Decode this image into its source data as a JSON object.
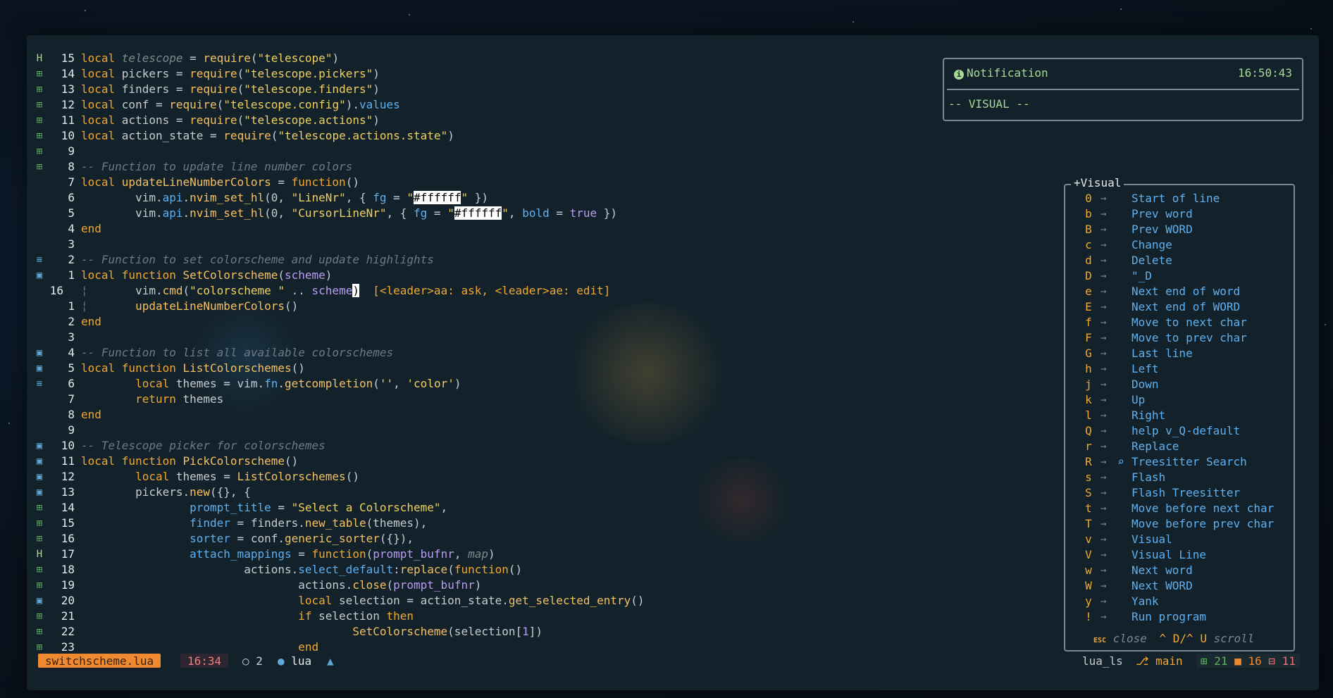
{
  "editor": {
    "lines": [
      {
        "sign": "H",
        "num": "15",
        "segs": [
          [
            "kw",
            "local "
          ],
          [
            "it",
            "telescope"
          ],
          [
            "var",
            " = "
          ],
          [
            "fn",
            "require"
          ],
          [
            "var",
            "("
          ],
          [
            "str",
            "\"telescope\""
          ],
          [
            "var",
            ")"
          ]
        ]
      },
      {
        "sign": "⊞",
        "num": "14",
        "segs": [
          [
            "kw",
            "local "
          ],
          [
            "var",
            "pickers = "
          ],
          [
            "fn",
            "require"
          ],
          [
            "var",
            "("
          ],
          [
            "str",
            "\"telescope.pickers\""
          ],
          [
            "var",
            ")"
          ]
        ]
      },
      {
        "sign": "⊞",
        "num": "13",
        "segs": [
          [
            "kw",
            "local "
          ],
          [
            "var",
            "finders = "
          ],
          [
            "fn",
            "require"
          ],
          [
            "var",
            "("
          ],
          [
            "str",
            "\"telescope.finders\""
          ],
          [
            "var",
            ")"
          ]
        ]
      },
      {
        "sign": "⊞",
        "num": "12",
        "segs": [
          [
            "kw",
            "local "
          ],
          [
            "var",
            "conf = "
          ],
          [
            "fn",
            "require"
          ],
          [
            "var",
            "("
          ],
          [
            "str",
            "\"telescope.config\""
          ],
          [
            "var",
            ")."
          ],
          [
            "prop",
            "values"
          ]
        ]
      },
      {
        "sign": "⊞",
        "num": "11",
        "segs": [
          [
            "kw",
            "local "
          ],
          [
            "var",
            "actions = "
          ],
          [
            "fn",
            "require"
          ],
          [
            "var",
            "("
          ],
          [
            "str",
            "\"telescope.actions\""
          ],
          [
            "var",
            ")"
          ]
        ]
      },
      {
        "sign": "⊞",
        "num": "10",
        "segs": [
          [
            "kw",
            "local "
          ],
          [
            "var",
            "action_state = "
          ],
          [
            "fn",
            "require"
          ],
          [
            "var",
            "("
          ],
          [
            "str",
            "\"telescope.actions.state\""
          ],
          [
            "var",
            ")"
          ]
        ]
      },
      {
        "sign": "⊞",
        "num": "9",
        "segs": []
      },
      {
        "sign": "⊞",
        "num": "8",
        "segs": [
          [
            "cm",
            "-- Function to update line number colors"
          ]
        ]
      },
      {
        "sign": "",
        "num": "7",
        "segs": [
          [
            "kw",
            "local "
          ],
          [
            "fn",
            "updateLineNumberColors"
          ],
          [
            "var",
            " = "
          ],
          [
            "kw",
            "function"
          ],
          [
            "var",
            "()"
          ]
        ]
      },
      {
        "sign": "",
        "num": "6",
        "segs": [
          [
            "var",
            "        vim."
          ],
          [
            "prop",
            "api"
          ],
          [
            "var",
            "."
          ],
          [
            "fn",
            "nvim_set_hl"
          ],
          [
            "var",
            "(0, "
          ],
          [
            "str",
            "\"LineNr\""
          ],
          [
            "var",
            ", { "
          ],
          [
            "prop",
            "fg"
          ],
          [
            "var",
            " = "
          ],
          [
            "str",
            "\""
          ],
          [
            "hl",
            "#ffffff"
          ],
          [
            "str",
            "\""
          ],
          [
            "var",
            " })"
          ]
        ]
      },
      {
        "sign": "",
        "num": "5",
        "segs": [
          [
            "var",
            "        vim."
          ],
          [
            "prop",
            "api"
          ],
          [
            "var",
            "."
          ],
          [
            "fn",
            "nvim_set_hl"
          ],
          [
            "var",
            "(0, "
          ],
          [
            "str",
            "\"CursorLineNr\""
          ],
          [
            "var",
            ", { "
          ],
          [
            "prop",
            "fg"
          ],
          [
            "var",
            " = "
          ],
          [
            "str",
            "\""
          ],
          [
            "hl",
            "#ffffff"
          ],
          [
            "str",
            "\""
          ],
          [
            "var",
            ", "
          ],
          [
            "prop",
            "bold"
          ],
          [
            "var",
            " = "
          ],
          [
            "bool",
            "true"
          ],
          [
            "var",
            " })"
          ]
        ]
      },
      {
        "sign": "",
        "num": "4",
        "segs": [
          [
            "kw",
            "end"
          ]
        ]
      },
      {
        "sign": "",
        "num": "3",
        "segs": []
      },
      {
        "sign": "≡",
        "num": "2",
        "segs": [
          [
            "cm",
            "-- Function to set colorscheme and update highlights"
          ]
        ]
      },
      {
        "sign": "▣",
        "num": "1",
        "segs": [
          [
            "kw",
            "local function "
          ],
          [
            "fn",
            "SetColorscheme"
          ],
          [
            "var",
            "("
          ],
          [
            "par",
            "scheme"
          ],
          [
            "var",
            ")"
          ]
        ]
      },
      {
        "sign": "",
        "num": "16",
        "cur": true,
        "segs": [
          [
            "cm",
            "¦       "
          ],
          [
            "var",
            "vim."
          ],
          [
            "fn",
            "cmd"
          ],
          [
            "var",
            "("
          ],
          [
            "str",
            "\"colorscheme \""
          ],
          [
            "var",
            " .. "
          ],
          [
            "par",
            "scheme"
          ],
          [
            "hl",
            ")"
          ],
          [
            "var",
            "  "
          ],
          [
            "hint",
            "[<leader>aa: ask, <leader>ae: edit]"
          ]
        ]
      },
      {
        "sign": "",
        "num": "1",
        "segs": [
          [
            "cm",
            "¦       "
          ],
          [
            "fn",
            "updateLineNumberColors"
          ],
          [
            "var",
            "()"
          ]
        ]
      },
      {
        "sign": "",
        "num": "2",
        "segs": [
          [
            "kw",
            "end"
          ]
        ]
      },
      {
        "sign": "",
        "num": "3",
        "segs": []
      },
      {
        "sign": "▣",
        "num": "4",
        "segs": [
          [
            "cm",
            "-- Function to list all available colorschemes"
          ]
        ]
      },
      {
        "sign": "▣",
        "num": "5",
        "segs": [
          [
            "kw",
            "local function "
          ],
          [
            "fn",
            "ListColorschemes"
          ],
          [
            "var",
            "()"
          ]
        ]
      },
      {
        "sign": "≡",
        "num": "6",
        "segs": [
          [
            "var",
            "        "
          ],
          [
            "kw",
            "local "
          ],
          [
            "var",
            "themes = vim."
          ],
          [
            "prop",
            "fn"
          ],
          [
            "var",
            "."
          ],
          [
            "fn",
            "getcompletion"
          ],
          [
            "var",
            "("
          ],
          [
            "str",
            "''"
          ],
          [
            "var",
            ", "
          ],
          [
            "str",
            "'color'"
          ],
          [
            "var",
            ")"
          ]
        ]
      },
      {
        "sign": "",
        "num": "7",
        "segs": [
          [
            "var",
            "        "
          ],
          [
            "kw",
            "return "
          ],
          [
            "var",
            "themes"
          ]
        ]
      },
      {
        "sign": "",
        "num": "8",
        "segs": [
          [
            "kw",
            "end"
          ]
        ]
      },
      {
        "sign": "",
        "num": "9",
        "segs": []
      },
      {
        "sign": "▣",
        "num": "10",
        "segs": [
          [
            "cm",
            "-- Telescope picker for colorschemes"
          ]
        ]
      },
      {
        "sign": "▣",
        "num": "11",
        "segs": [
          [
            "kw",
            "local function "
          ],
          [
            "fn",
            "PickColorscheme"
          ],
          [
            "var",
            "()"
          ]
        ]
      },
      {
        "sign": "▣",
        "num": "12",
        "segs": [
          [
            "var",
            "        "
          ],
          [
            "kw",
            "local "
          ],
          [
            "var",
            "themes = "
          ],
          [
            "fn",
            "ListColorschemes"
          ],
          [
            "var",
            "()"
          ]
        ]
      },
      {
        "sign": "▣",
        "num": "13",
        "segs": [
          [
            "var",
            "        pickers."
          ],
          [
            "fn",
            "new"
          ],
          [
            "var",
            "({}, {"
          ]
        ]
      },
      {
        "sign": "⊞",
        "num": "14",
        "segs": [
          [
            "var",
            "                "
          ],
          [
            "prop",
            "prompt_title"
          ],
          [
            "var",
            " = "
          ],
          [
            "str",
            "\"Select a Colorscheme\""
          ],
          [
            "var",
            ","
          ]
        ]
      },
      {
        "sign": "⊞",
        "num": "15",
        "segs": [
          [
            "var",
            "                "
          ],
          [
            "prop",
            "finder"
          ],
          [
            "var",
            " = finders."
          ],
          [
            "fn",
            "new_table"
          ],
          [
            "var",
            "(themes),"
          ]
        ]
      },
      {
        "sign": "⊞",
        "num": "16",
        "segs": [
          [
            "var",
            "                "
          ],
          [
            "prop",
            "sorter"
          ],
          [
            "var",
            " = conf."
          ],
          [
            "fn",
            "generic_sorter"
          ],
          [
            "var",
            "({}),"
          ]
        ]
      },
      {
        "sign": "H",
        "num": "17",
        "segs": [
          [
            "var",
            "                "
          ],
          [
            "prop",
            "attach_mappings"
          ],
          [
            "var",
            " = "
          ],
          [
            "kw",
            "function"
          ],
          [
            "var",
            "("
          ],
          [
            "par",
            "prompt_bufnr"
          ],
          [
            "var",
            ", "
          ],
          [
            "it",
            "map"
          ],
          [
            "var",
            ")"
          ]
        ]
      },
      {
        "sign": "⊞",
        "num": "18",
        "segs": [
          [
            "var",
            "                        actions."
          ],
          [
            "prop",
            "select_default"
          ],
          [
            "var",
            ":"
          ],
          [
            "fn",
            "replace"
          ],
          [
            "var",
            "("
          ],
          [
            "kw",
            "function"
          ],
          [
            "var",
            "()"
          ]
        ]
      },
      {
        "sign": "⊞",
        "num": "19",
        "segs": [
          [
            "var",
            "                                actions."
          ],
          [
            "fn",
            "close"
          ],
          [
            "var",
            "("
          ],
          [
            "par",
            "prompt_bufnr"
          ],
          [
            "var",
            ")"
          ]
        ]
      },
      {
        "sign": "▣",
        "num": "20",
        "segs": [
          [
            "var",
            "                                "
          ],
          [
            "kw",
            "local "
          ],
          [
            "var",
            "selection = action_state."
          ],
          [
            "fn",
            "get_selected_entry"
          ],
          [
            "var",
            "()"
          ]
        ]
      },
      {
        "sign": "⊞",
        "num": "21",
        "segs": [
          [
            "var",
            "                                "
          ],
          [
            "kw",
            "if "
          ],
          [
            "var",
            "selection "
          ],
          [
            "kw",
            "then"
          ]
        ]
      },
      {
        "sign": "⊞",
        "num": "22",
        "segs": [
          [
            "var",
            "                                        "
          ],
          [
            "fn",
            "SetColorscheme"
          ],
          [
            "var",
            "(selection["
          ],
          [
            "bool",
            "1"
          ],
          [
            "var",
            "])"
          ]
        ]
      },
      {
        "sign": "⊞",
        "num": "23",
        "segs": [
          [
            "var",
            "                                "
          ],
          [
            "kw",
            "end"
          ]
        ]
      }
    ]
  },
  "notification": {
    "title": "Notification",
    "time": "16:50:43",
    "body": "-- VISUAL --"
  },
  "which_key": {
    "title": "+Visual",
    "items": [
      {
        "key": "0",
        "desc": "Start of line"
      },
      {
        "key": "b",
        "desc": "Prev word"
      },
      {
        "key": "B",
        "desc": "Prev WORD"
      },
      {
        "key": "c",
        "desc": "Change"
      },
      {
        "key": "d",
        "desc": "Delete"
      },
      {
        "key": "D",
        "desc": "\"_D"
      },
      {
        "key": "e",
        "desc": "Next end of word"
      },
      {
        "key": "E",
        "desc": "Next end of WORD"
      },
      {
        "key": "f",
        "desc": "Move to next char"
      },
      {
        "key": "F",
        "desc": "Move to prev char"
      },
      {
        "key": "G",
        "desc": "Last line"
      },
      {
        "key": "h",
        "desc": "Left"
      },
      {
        "key": "j",
        "desc": "Down"
      },
      {
        "key": "k",
        "desc": "Up"
      },
      {
        "key": "l",
        "desc": "Right"
      },
      {
        "key": "Q",
        "desc": "help v_Q-default"
      },
      {
        "key": "r",
        "desc": "Replace"
      },
      {
        "key": "R",
        "desc": "Treesitter Search",
        "icon": "search-icon"
      },
      {
        "key": "s",
        "desc": "Flash"
      },
      {
        "key": "S",
        "desc": "Flash Treesitter"
      },
      {
        "key": "t",
        "desc": "Move before next char"
      },
      {
        "key": "T",
        "desc": "Move before prev char"
      },
      {
        "key": "v",
        "desc": "Visual"
      },
      {
        "key": "V",
        "desc": "Visual Line"
      },
      {
        "key": "w",
        "desc": "Next word"
      },
      {
        "key": "W",
        "desc": "Next WORD"
      },
      {
        "key": "y",
        "desc": "Yank"
      },
      {
        "key": "!",
        "desc": "Run program"
      }
    ],
    "footer_esc": "ESC",
    "footer_close": "close",
    "footer_scroll_keys": "^ D/^ U",
    "footer_scroll": "scroll"
  },
  "statusbar": {
    "file": "switchscheme.lua",
    "position": "16:34",
    "diagnostics": "2",
    "language": "lua",
    "lsp": "lua_ls",
    "branch": "main",
    "git_added": "21",
    "git_changed": "16",
    "git_removed": "11"
  },
  "colors": {
    "accent": "#f08a30",
    "keyword": "#f0a830",
    "property": "#5fb0f0",
    "string": "#f0d060",
    "git_add": "#5faf5f",
    "git_remove": "#f07080"
  }
}
